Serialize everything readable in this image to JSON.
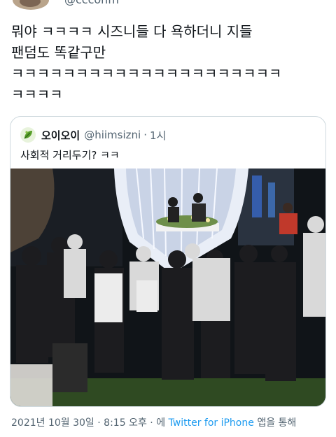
{
  "author": {
    "handle": "@ccconm"
  },
  "tweet": {
    "lines": [
      "뭐야 ㅋㅋㅋㅋ 시즈니들 다 욕하더니 지들",
      "팬덤도 똑같구만",
      "ㅋㅋㅋㅋㅋㅋㅋㅋㅋㅋㅋㅋㅋㅋㅋㅋㅋㅋㅋㅋㅋ",
      "ㅋㅋㅋㅋ"
    ]
  },
  "quoted": {
    "icon": "leaf-icon",
    "name": "오이오이",
    "handle": "@hiimsizni",
    "separator": "·",
    "time": "1시",
    "text": "사회적 거리두기? ㅋㅋ",
    "colors": {
      "stage_light": "#e9eef7",
      "grass": "#2f4a22",
      "red_shirt": "#c0392b"
    }
  },
  "meta": {
    "date": "2021년 10월 30일",
    "time": "8:15 오후",
    "via_prefix": "에",
    "client": "Twitter for iPhone",
    "via_suffix": "앱을 통해"
  }
}
